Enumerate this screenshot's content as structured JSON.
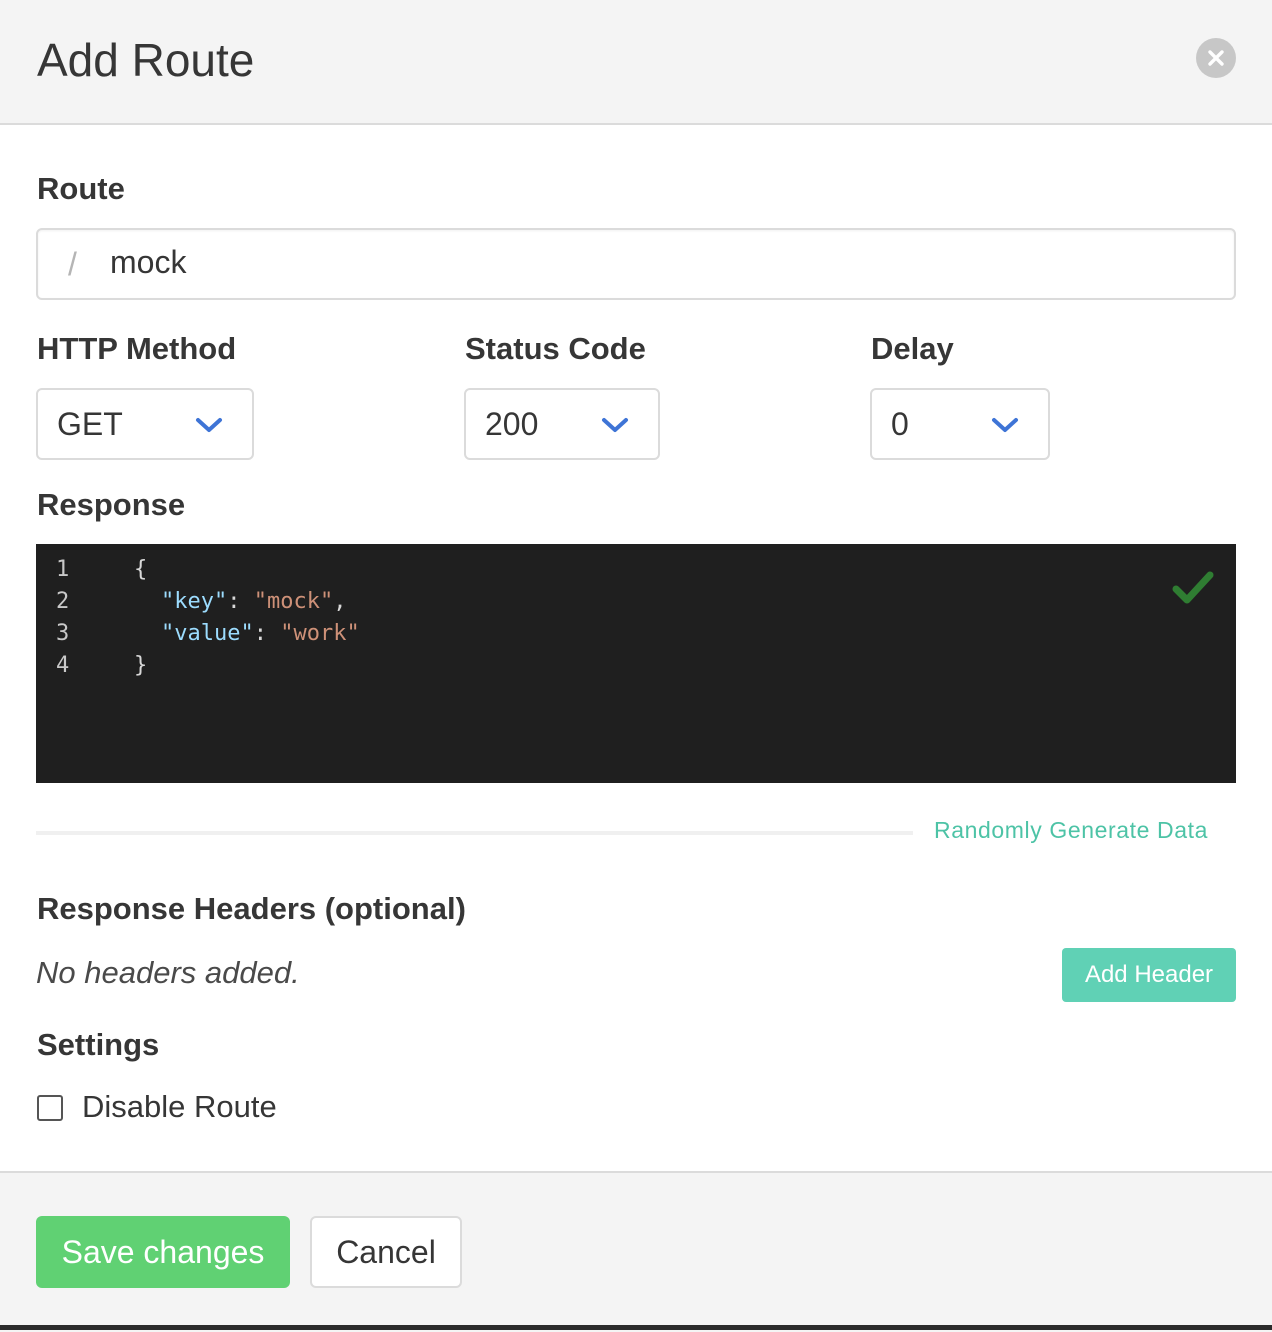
{
  "modal": {
    "title": "Add Route",
    "close_icon": "close-icon"
  },
  "route": {
    "label": "Route",
    "prefix": "/",
    "value": "mock"
  },
  "http_method": {
    "label": "HTTP Method",
    "selected": "GET"
  },
  "status_code": {
    "label": "Status Code",
    "selected": "200"
  },
  "delay": {
    "label": "Delay",
    "selected": "0"
  },
  "response": {
    "label": "Response",
    "line_numbers": [
      "1",
      "2",
      "3",
      "4"
    ],
    "lines": {
      "open": "{",
      "key1": "\"key\"",
      "sep1": ": ",
      "val1": "\"mock\"",
      "comma1": ",",
      "key2": "\"value\"",
      "sep2": ": ",
      "val2": "\"work\"",
      "close": "}"
    },
    "valid_icon": "checkmark-icon",
    "generate_link": "Randomly Generate Data"
  },
  "headers": {
    "label": "Response Headers (optional)",
    "empty_text": "No headers added.",
    "add_button": "Add Header"
  },
  "settings": {
    "label": "Settings",
    "disable_route_label": "Disable Route",
    "disable_route_checked": false
  },
  "footer": {
    "save_label": "Save changes",
    "cancel_label": "Cancel"
  },
  "colors": {
    "accent_green": "#60d173",
    "accent_teal": "#60d1b5",
    "chevron_blue": "#3e74d6",
    "editor_bg": "#1f1f1f"
  }
}
